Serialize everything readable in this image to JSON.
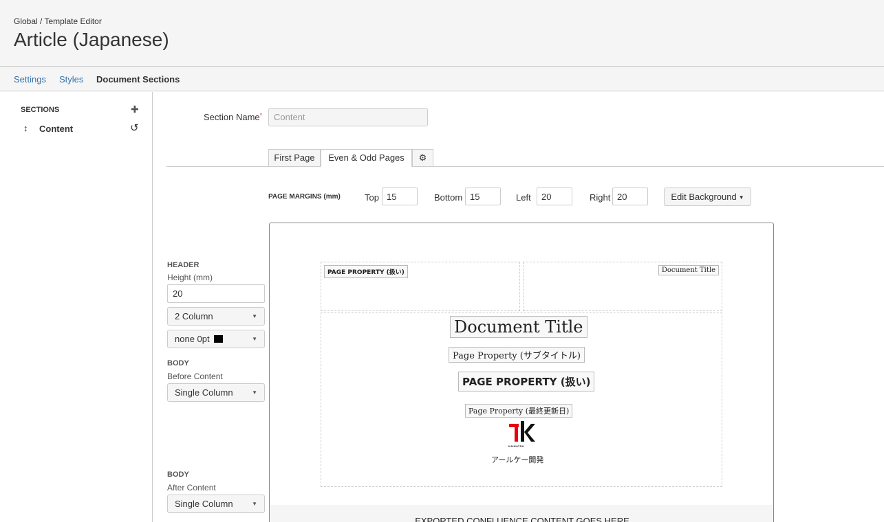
{
  "breadcrumb": "Global  /  Template Editor",
  "title": "Article (Japanese)",
  "tabs": {
    "settings": "Settings",
    "styles": "Styles",
    "document_sections": "Document Sections"
  },
  "sidebar": {
    "label": "SECTIONS",
    "add_icon": "plus-icon",
    "items": [
      {
        "label": "Content",
        "icon": "drag-icon",
        "action_icon": "reset-icon"
      }
    ]
  },
  "section_name": {
    "label": "Section Name",
    "required_mark": "*",
    "value": "Content"
  },
  "page_tabs": {
    "first": "First Page",
    "even_odd": "Even & Odd Pages",
    "settings_icon": "gear-icon"
  },
  "margins": {
    "label": "PAGE MARGINS (mm)",
    "top": {
      "label": "Top",
      "value": "15"
    },
    "bottom": {
      "label": "Bottom",
      "value": "15"
    },
    "left": {
      "label": "Left",
      "value": "20"
    },
    "right": {
      "label": "Right",
      "value": "20"
    },
    "edit_background": "Edit Background"
  },
  "header_settings": {
    "title": "HEADER",
    "height_label": "Height (mm)",
    "height": "20",
    "columns": "2 Column",
    "border": "none 0pt"
  },
  "body_before": {
    "title": "BODY",
    "subtitle": "Before Content",
    "layout": "Single Column"
  },
  "body_after": {
    "title": "BODY",
    "subtitle": "After Content",
    "layout": "Single Column"
  },
  "preview": {
    "header_left": "PAGE PROPERTY (扱い)",
    "header_right": "Document Title",
    "doc_title": "Document Title",
    "subtitle_prop": "Page Property (サブタイトル)",
    "handling_prop": "PAGE PROPERTY (扱い)",
    "updated_prop": "Page Property (最終更新日)",
    "logo_text": "KAIHATSU",
    "company": "アールケー開発",
    "exported": "EXPORTED CONFLUENCE CONTENT GOES HERE"
  },
  "colors": {
    "link": "#3572b0",
    "required": "#d04437",
    "logo_red": "#e60012"
  }
}
